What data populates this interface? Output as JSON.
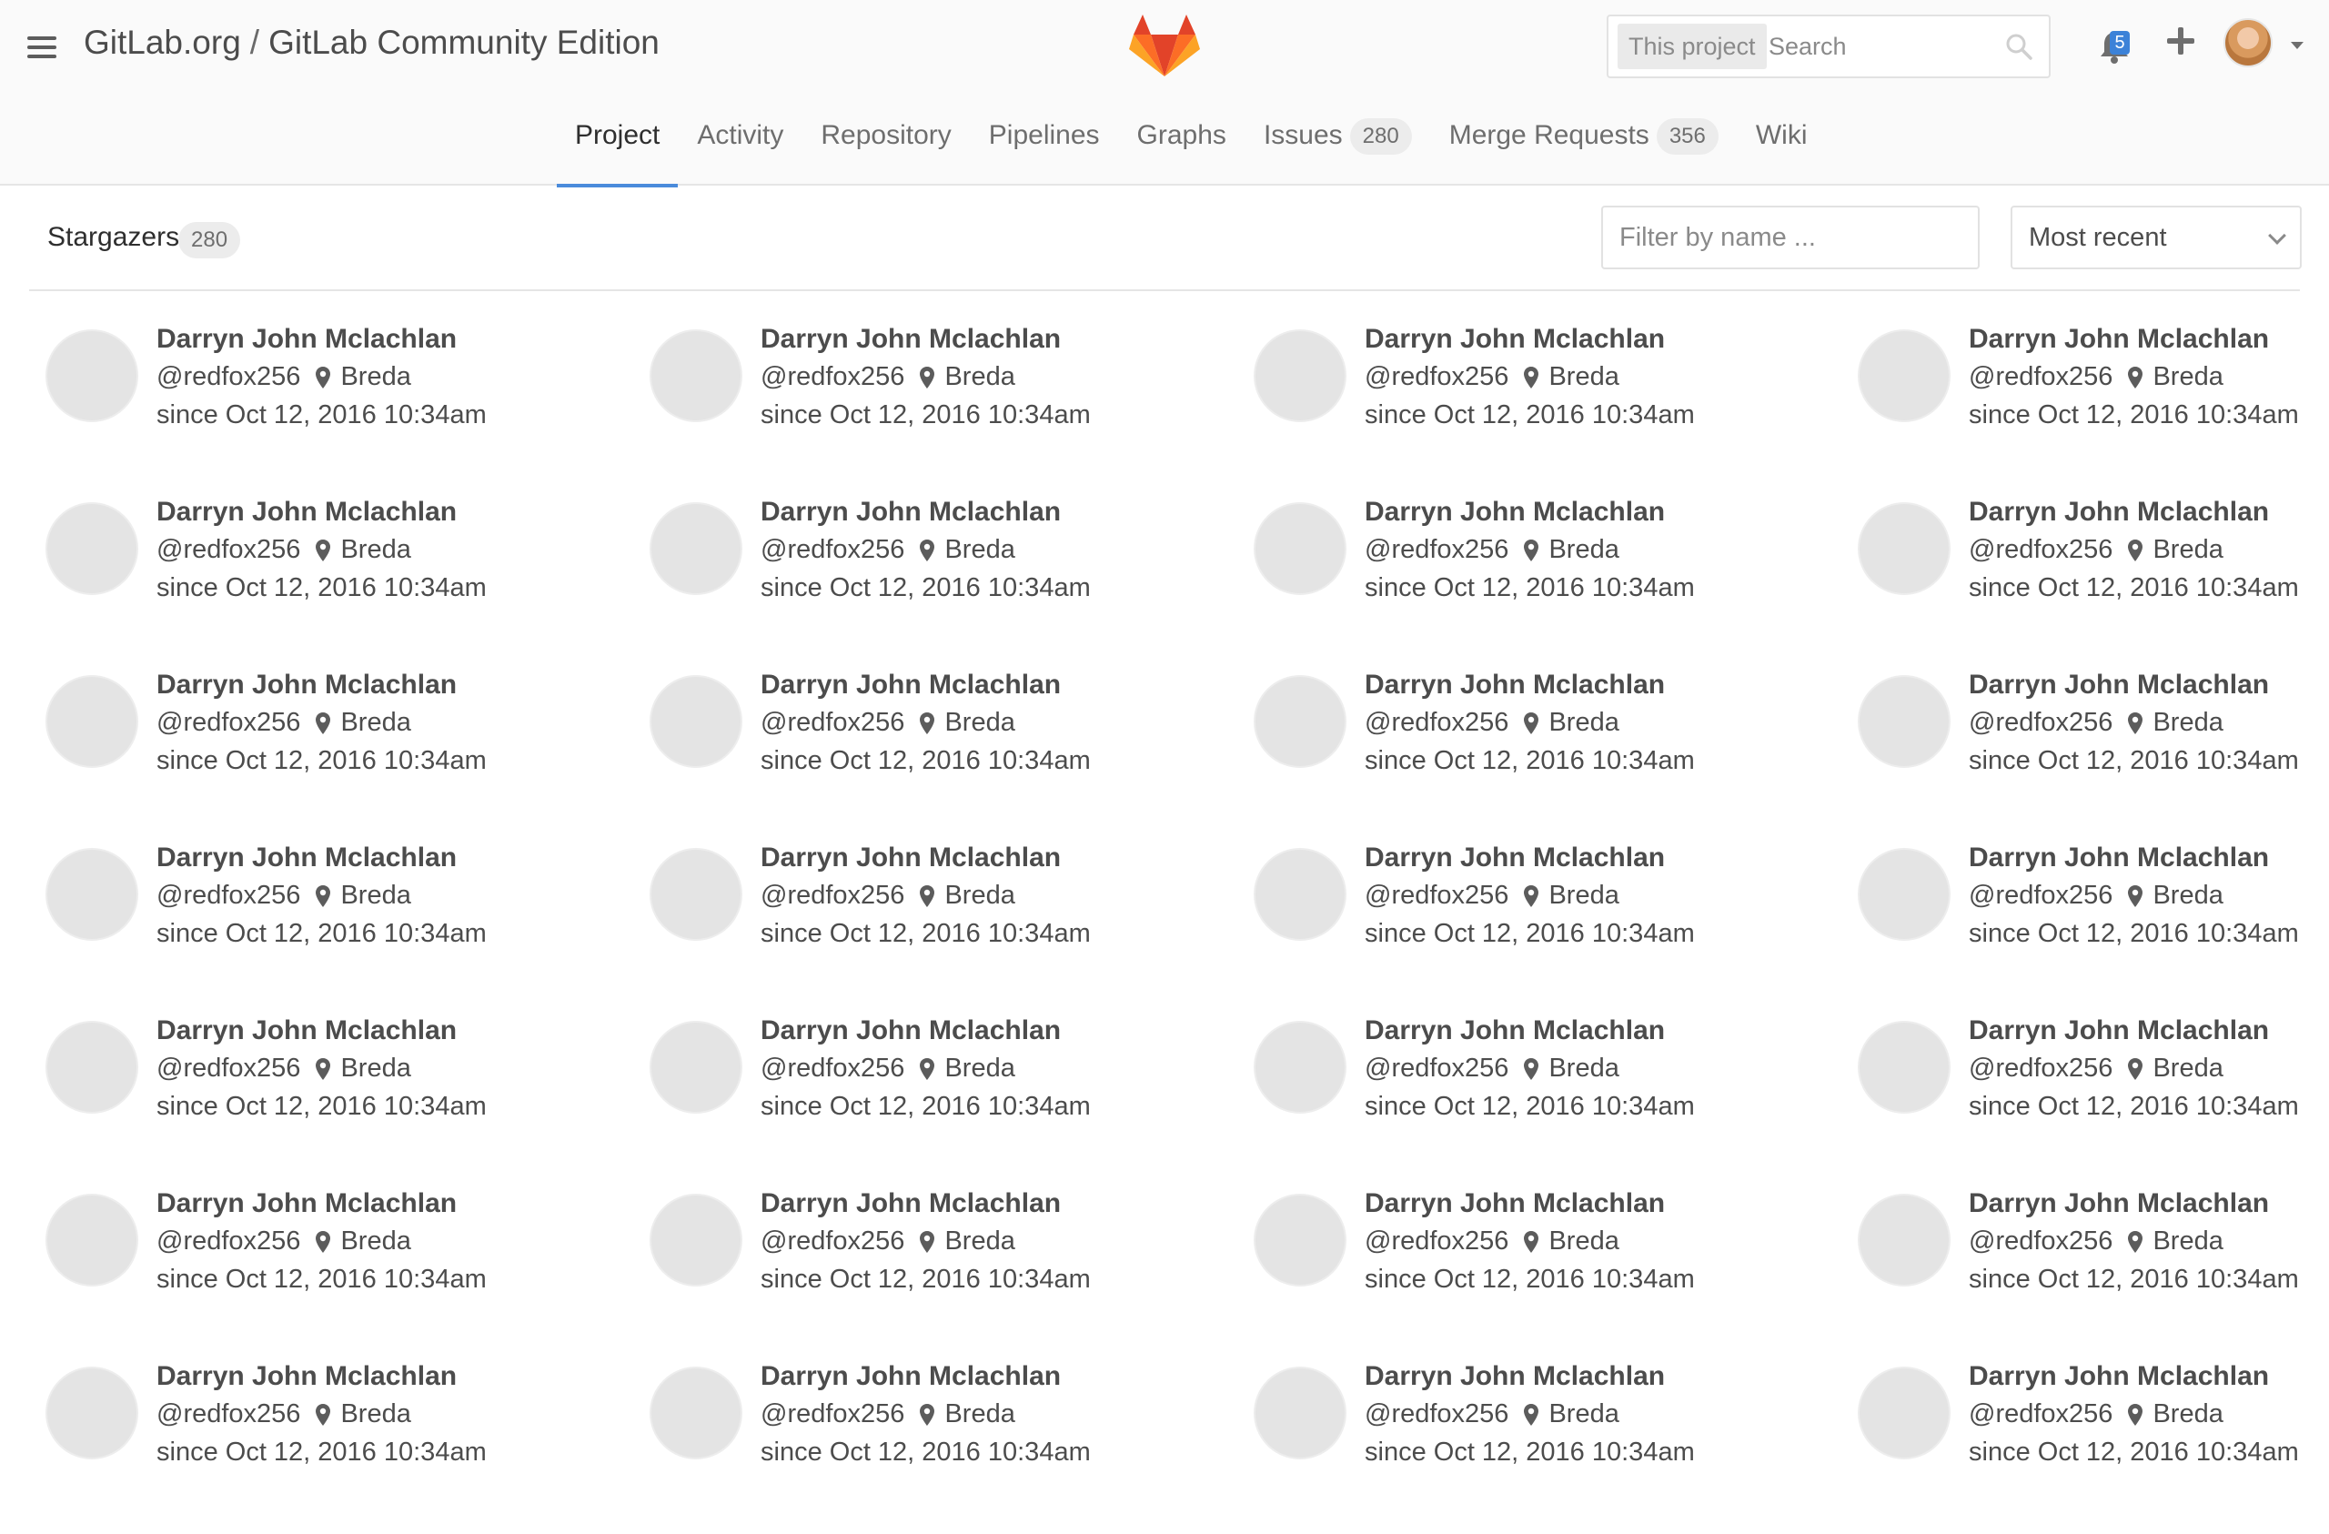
{
  "header": {
    "group": "GitLab.org",
    "separator": "/",
    "project": "GitLab Community Edition",
    "search_scope": "This project",
    "search_placeholder": "Search",
    "notification_count": "5",
    "brand_color": "#e24329",
    "accent_color": "#4a8bdb"
  },
  "tabs": [
    {
      "label": "Project",
      "badge": null,
      "active": true
    },
    {
      "label": "Activity",
      "badge": null
    },
    {
      "label": "Repository",
      "badge": null
    },
    {
      "label": "Pipelines",
      "badge": null
    },
    {
      "label": "Graphs",
      "badge": null
    },
    {
      "label": "Issues",
      "badge": "280"
    },
    {
      "label": "Merge Requests",
      "badge": "356"
    },
    {
      "label": "Wiki",
      "badge": null
    }
  ],
  "list": {
    "title": "Stargazers",
    "count": "280",
    "filter_placeholder": "Filter by name ...",
    "sort_value": "Most recent"
  },
  "users": [
    {
      "name": "Darryn John Mclachlan",
      "handle": "@redfox256",
      "location": "Breda",
      "since": "since Oct 12, 2016 10:34am"
    },
    {
      "name": "Darryn John Mclachlan",
      "handle": "@redfox256",
      "location": "Breda",
      "since": "since Oct 12, 2016 10:34am"
    },
    {
      "name": "Darryn John Mclachlan",
      "handle": "@redfox256",
      "location": "Breda",
      "since": "since Oct 12, 2016 10:34am"
    },
    {
      "name": "Darryn John Mclachlan",
      "handle": "@redfox256",
      "location": "Breda",
      "since": "since Oct 12, 2016 10:34am"
    },
    {
      "name": "Darryn John Mclachlan",
      "handle": "@redfox256",
      "location": "Breda",
      "since": "since Oct 12, 2016 10:34am"
    },
    {
      "name": "Darryn John Mclachlan",
      "handle": "@redfox256",
      "location": "Breda",
      "since": "since Oct 12, 2016 10:34am"
    },
    {
      "name": "Darryn John Mclachlan",
      "handle": "@redfox256",
      "location": "Breda",
      "since": "since Oct 12, 2016 10:34am"
    },
    {
      "name": "Darryn John Mclachlan",
      "handle": "@redfox256",
      "location": "Breda",
      "since": "since Oct 12, 2016 10:34am"
    },
    {
      "name": "Darryn John Mclachlan",
      "handle": "@redfox256",
      "location": "Breda",
      "since": "since Oct 12, 2016 10:34am"
    },
    {
      "name": "Darryn John Mclachlan",
      "handle": "@redfox256",
      "location": "Breda",
      "since": "since Oct 12, 2016 10:34am"
    },
    {
      "name": "Darryn John Mclachlan",
      "handle": "@redfox256",
      "location": "Breda",
      "since": "since Oct 12, 2016 10:34am"
    },
    {
      "name": "Darryn John Mclachlan",
      "handle": "@redfox256",
      "location": "Breda",
      "since": "since Oct 12, 2016 10:34am"
    },
    {
      "name": "Darryn John Mclachlan",
      "handle": "@redfox256",
      "location": "Breda",
      "since": "since Oct 12, 2016 10:34am"
    },
    {
      "name": "Darryn John Mclachlan",
      "handle": "@redfox256",
      "location": "Breda",
      "since": "since Oct 12, 2016 10:34am"
    },
    {
      "name": "Darryn John Mclachlan",
      "handle": "@redfox256",
      "location": "Breda",
      "since": "since Oct 12, 2016 10:34am"
    },
    {
      "name": "Darryn John Mclachlan",
      "handle": "@redfox256",
      "location": "Breda",
      "since": "since Oct 12, 2016 10:34am"
    },
    {
      "name": "Darryn John Mclachlan",
      "handle": "@redfox256",
      "location": "Breda",
      "since": "since Oct 12, 2016 10:34am"
    },
    {
      "name": "Darryn John Mclachlan",
      "handle": "@redfox256",
      "location": "Breda",
      "since": "since Oct 12, 2016 10:34am"
    },
    {
      "name": "Darryn John Mclachlan",
      "handle": "@redfox256",
      "location": "Breda",
      "since": "since Oct 12, 2016 10:34am"
    },
    {
      "name": "Darryn John Mclachlan",
      "handle": "@redfox256",
      "location": "Breda",
      "since": "since Oct 12, 2016 10:34am"
    },
    {
      "name": "Darryn John Mclachlan",
      "handle": "@redfox256",
      "location": "Breda",
      "since": "since Oct 12, 2016 10:34am"
    },
    {
      "name": "Darryn John Mclachlan",
      "handle": "@redfox256",
      "location": "Breda",
      "since": "since Oct 12, 2016 10:34am"
    },
    {
      "name": "Darryn John Mclachlan",
      "handle": "@redfox256",
      "location": "Breda",
      "since": "since Oct 12, 2016 10:34am"
    },
    {
      "name": "Darryn John Mclachlan",
      "handle": "@redfox256",
      "location": "Breda",
      "since": "since Oct 12, 2016 10:34am"
    },
    {
      "name": "Darryn John Mclachlan",
      "handle": "@redfox256",
      "location": "Breda",
      "since": "since Oct 12, 2016 10:34am"
    },
    {
      "name": "Darryn John Mclachlan",
      "handle": "@redfox256",
      "location": "Breda",
      "since": "since Oct 12, 2016 10:34am"
    },
    {
      "name": "Darryn John Mclachlan",
      "handle": "@redfox256",
      "location": "Breda",
      "since": "since Oct 12, 2016 10:34am"
    },
    {
      "name": "Darryn John Mclachlan",
      "handle": "@redfox256",
      "location": "Breda",
      "since": "since Oct 12, 2016 10:34am"
    }
  ]
}
